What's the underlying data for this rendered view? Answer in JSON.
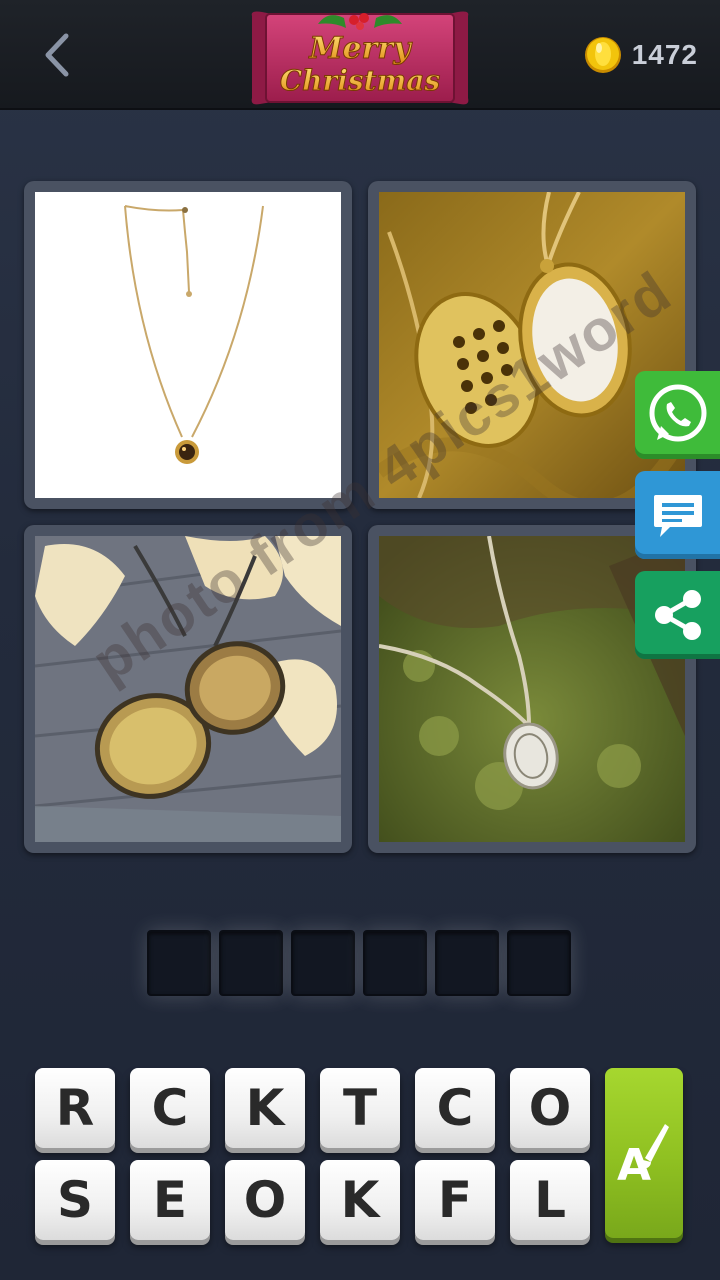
{
  "header": {
    "banner_line1": "Merry",
    "banner_line2": "Christmas",
    "coins": "1472"
  },
  "watermark": "photo from 4pics1word",
  "answer": {
    "length": 6
  },
  "keys": {
    "row1": [
      "R",
      "C",
      "K",
      "T",
      "C",
      "O"
    ],
    "row2": [
      "S",
      "E",
      "O",
      "K",
      "F",
      "L"
    ]
  },
  "colors": {
    "whatsapp": "#3fbb3a",
    "message": "#2f97d6",
    "share": "#17a05f",
    "hint": "#8fc021",
    "coin": "#f2c40c"
  },
  "icons": {
    "back": "chevron-left-icon",
    "coin": "coin-icon",
    "whatsapp": "whatsapp-icon",
    "message": "message-icon",
    "share": "share-icon",
    "hint": "paintbrush-a-icon"
  }
}
